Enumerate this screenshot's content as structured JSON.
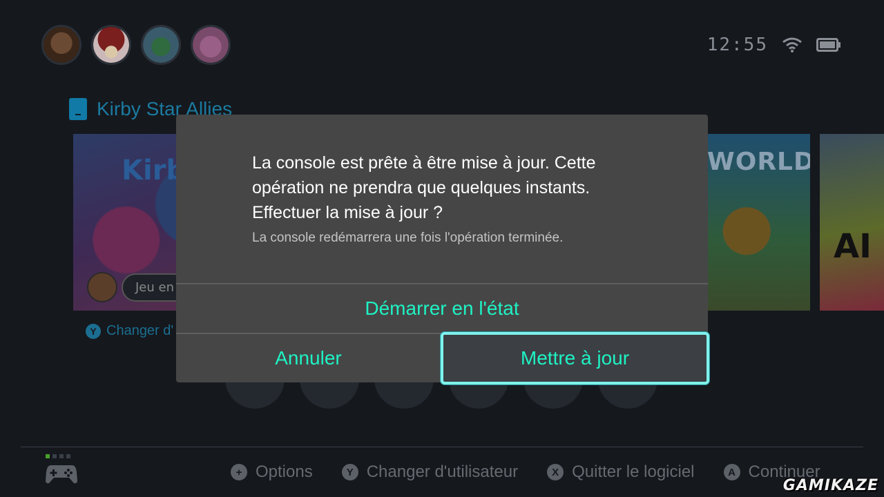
{
  "status": {
    "clock": "12:55",
    "wifi_icon": "wifi-icon",
    "battery_icon": "battery-icon"
  },
  "home": {
    "users": [
      "donkey-kong-avatar",
      "mushroom-avatar",
      "yoshi-egg-avatar",
      "isabelle-avatar"
    ],
    "selected_game_title": "Kirby Star Allies",
    "tile_texts": {
      "kirby_logo": "Kirb",
      "playing_pill": "Jeu en",
      "lego": "WORLDS",
      "arms": "AI"
    },
    "change_user_hint": "Changer d'",
    "change_user_badge": "Y"
  },
  "dialog": {
    "message": "La console est prête à être mise à jour. Cette opération ne prendra que quelques instants. Effectuer la mise à jour ?",
    "submessage": "La console redémarrera une fois l'opération terminée.",
    "start_button": "Démarrer en l'état",
    "cancel_button": "Annuler",
    "update_button": "Mettre à jour",
    "accent_color": "#1ff2c4",
    "focus_color": "#7ef2ec"
  },
  "footer": {
    "hints": [
      {
        "badge": "+",
        "label": "Options"
      },
      {
        "badge": "Y",
        "label": "Changer d'utilisateur"
      },
      {
        "badge": "X",
        "label": "Quitter le logiciel"
      },
      {
        "badge": "A",
        "label": "Continuer"
      }
    ]
  },
  "watermark": "GAMIKAZE"
}
